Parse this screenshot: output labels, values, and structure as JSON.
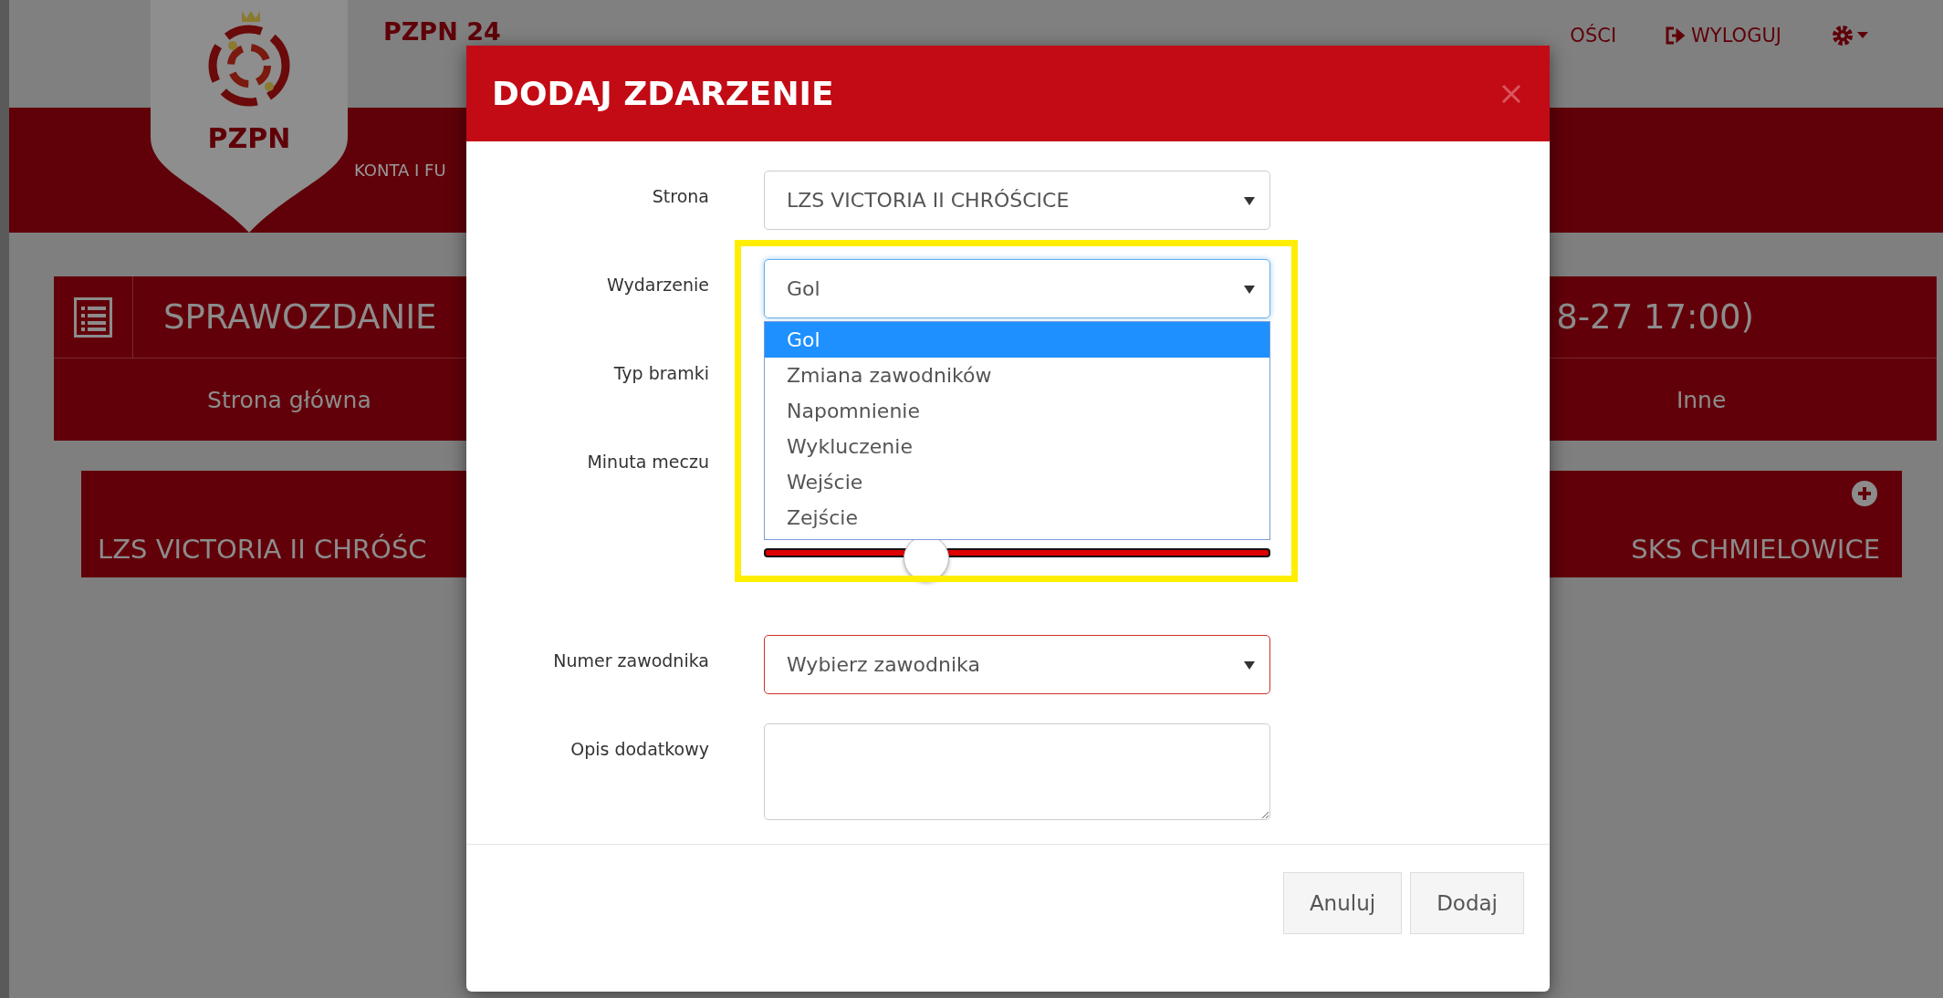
{
  "header": {
    "brand": "PZPN 24",
    "logo_text": "PZPN",
    "nav_item": "KONTA I FU",
    "messages": "OŚCI",
    "logout": "WYLOGUJ"
  },
  "report": {
    "title": "SPRAWOZDANIE",
    "title_end": "8-27 17:00)",
    "tabs": [
      {
        "label": "Strona główna"
      },
      {
        "label": "Inne"
      }
    ],
    "home_team": "LZS VICTORIA II CHRÓŚC",
    "away_team": "SKS CHMIELOWICE"
  },
  "dialog": {
    "title": "DODAJ ZDARZENIE",
    "fields": [
      {
        "kind": "select",
        "label": "Strona",
        "value": "LZS VICTORIA II CHRÓŚCICE"
      },
      {
        "kind": "select",
        "label": "Wydarzenie",
        "value": "Gol",
        "focused": true,
        "highlighted": true,
        "options": [
          {
            "label": "Gol",
            "selected": true
          },
          {
            "label": "Zmiana zawodników",
            "selected": false
          },
          {
            "label": "Napomnienie",
            "selected": false
          },
          {
            "label": "Wykluczenie",
            "selected": false
          },
          {
            "label": "Wejście",
            "selected": false
          },
          {
            "label": "Zejście",
            "selected": false
          }
        ]
      },
      {
        "kind": "covered",
        "label": "Typ bramki"
      },
      {
        "kind": "slider",
        "label": "Minuta meczu",
        "level": 0.32
      },
      {
        "kind": "select",
        "label": "Numer zawodnika",
        "placeholder": "Wybierz zawodnika",
        "invalid": true
      },
      {
        "kind": "textarea",
        "label": "Opis dodatkowy"
      }
    ],
    "buttons": [
      "Anuluj",
      "Dodaj"
    ]
  }
}
